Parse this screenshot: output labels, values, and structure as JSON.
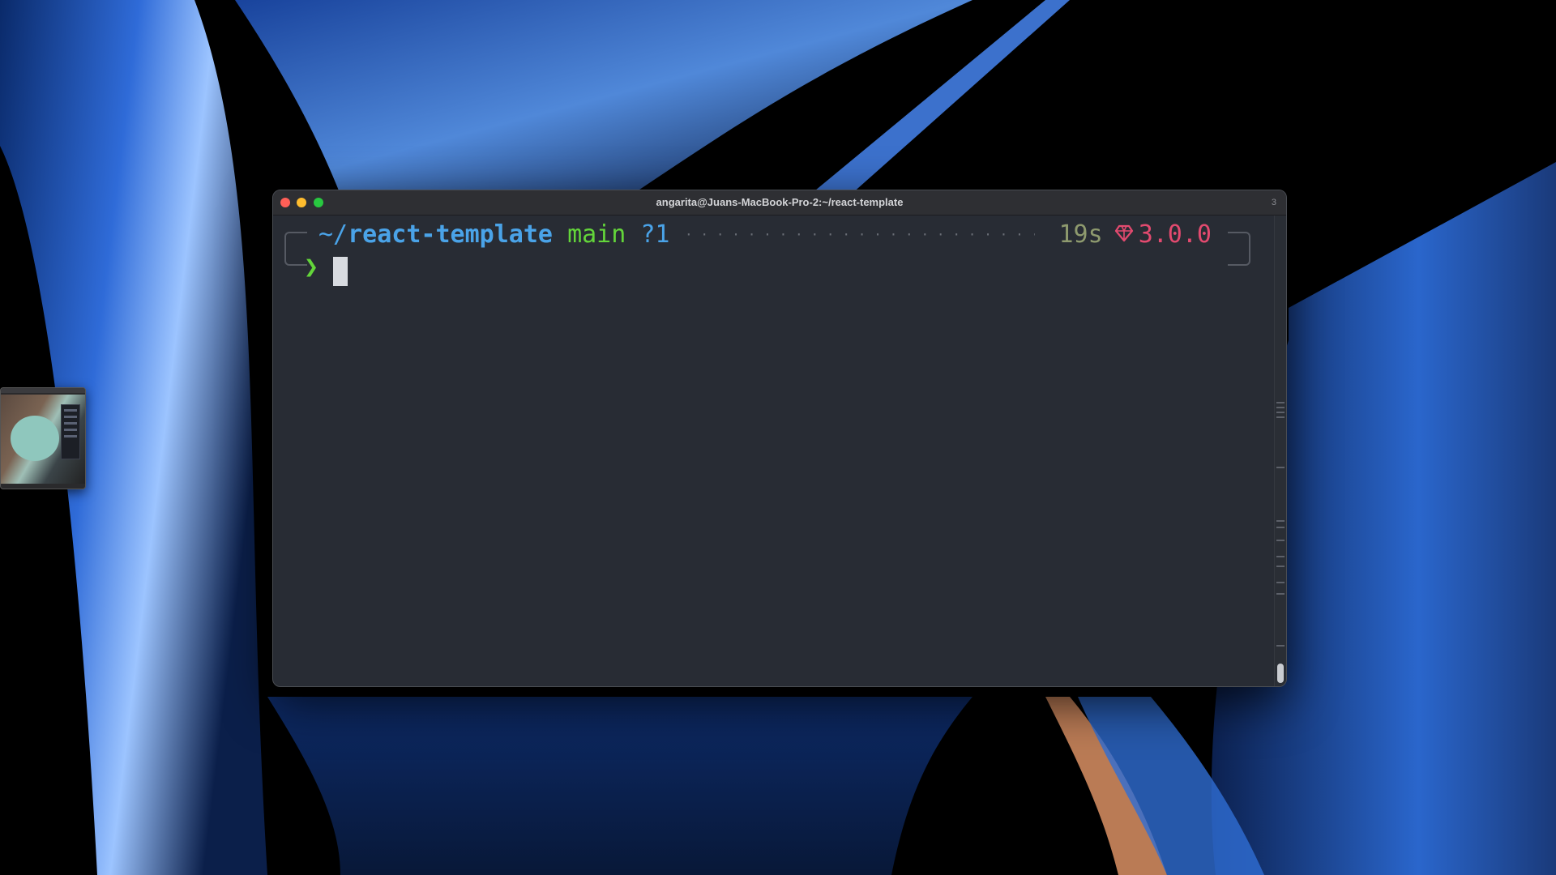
{
  "terminal": {
    "title": "angarita@Juans-MacBook-Pro-2:~/react-template",
    "tab_count": "3",
    "prompt": {
      "path_prefix": "~/",
      "path": "react-template",
      "branch": "main",
      "git_status": "?1",
      "dots": "····································",
      "duration": "19s",
      "ruby_icon": "gem-icon",
      "ruby_version": "3.0.0",
      "symbol": "❯"
    }
  },
  "colors": {
    "background": "#282c34",
    "path": "#4aa3e8",
    "branch": "#63d53a",
    "duration": "#8e9a6e",
    "ruby": "#e34a6f"
  }
}
